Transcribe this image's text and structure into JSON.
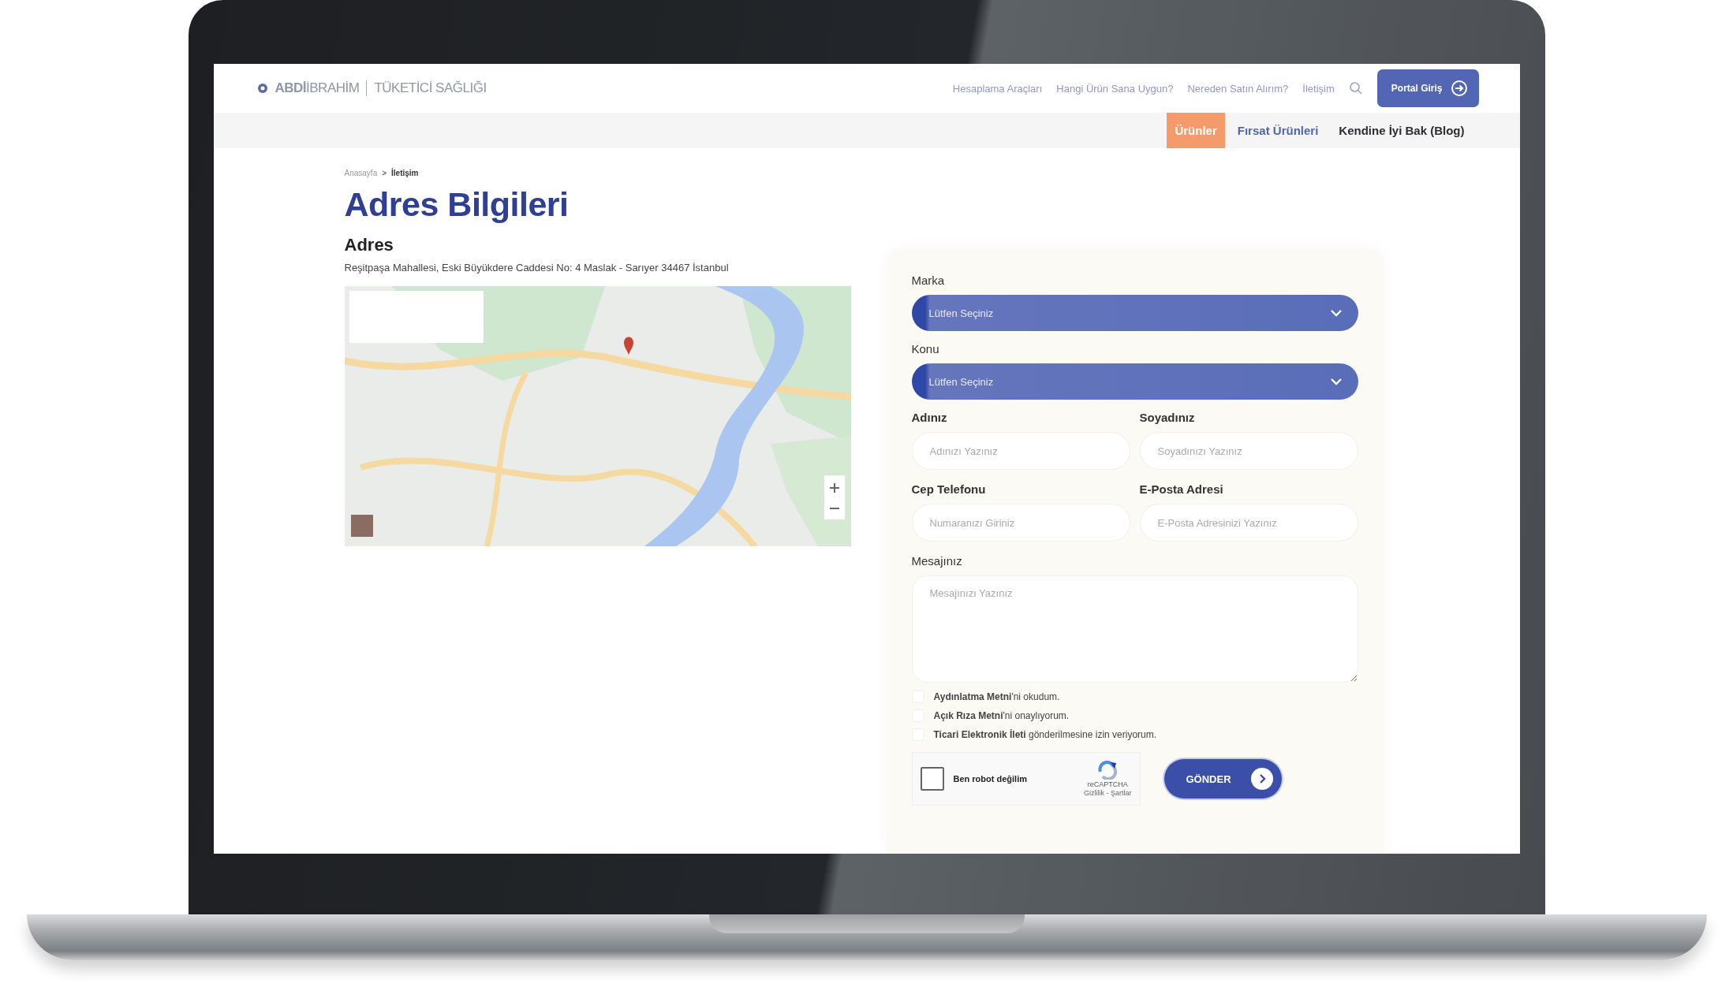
{
  "logo": {
    "brand": "**ABDİ**İBRAHİM",
    "subtitle": "TÜKETİCİ SAĞLIĞI"
  },
  "top_nav": [
    "Hesaplama Araçları",
    "Hangi Ürün Sana Uygun?",
    "Nereden Satın Alırım?",
    "İletişim"
  ],
  "portal_button": "Portal Giriş",
  "menu": [
    {
      "label": "Ürünler",
      "selected": true
    },
    {
      "label": "Fırsat Ürünleri",
      "selected": false
    },
    {
      "label": "Kendine İyi Bak (Blog)",
      "selected": false
    }
  ],
  "breadcrumb": {
    "separator": ">",
    "items": [
      {
        "label": "Anasayfa",
        "current": false
      },
      {
        "label": "İletişim",
        "current": true
      }
    ]
  },
  "title": "Adres Bilgileri",
  "address": {
    "heading": "Adres",
    "text": "Reşitpaşa Mahallesi, Eski Büyükdere Caddesi No: 4 Maslak - Sarıyer 34467 İstanbul"
  },
  "form": {
    "fields": [
      {
        "kind": "select",
        "label": "Marka",
        "value": "Lütfen Seçiniz"
      },
      {
        "kind": "select",
        "label": "Konu",
        "value": "Lütfen Seçiniz"
      },
      {
        "kind": "text",
        "label": "Adınız",
        "placeholder": "Adınızı Yazınız"
      },
      {
        "kind": "text",
        "label": "Soyadınız",
        "placeholder": "Soyadınızı Yazınız"
      },
      {
        "kind": "text",
        "label": "Cep Telefonu",
        "placeholder": "Numaranızı Giriniz"
      },
      {
        "kind": "text",
        "label": "E-Posta Adresi",
        "placeholder": "E-Posta Adresinizi Yazınız"
      },
      {
        "kind": "textarea",
        "label": "Mesajınız",
        "placeholder": "Mesajınızı Yazınız"
      }
    ],
    "consents": [
      {
        "text": "**Aydınlatma Metni**'ni okudum.",
        "checked": false
      },
      {
        "text": "**Açık Rıza Metni**'ni onaylıyorum.",
        "checked": false
      },
      {
        "text": "**Ticari Elektronik İleti** gönderilmesine izin veriyorum.",
        "checked": false
      }
    ],
    "captcha": {
      "label": "Ben robot değilim",
      "checked": false,
      "brand": "reCAPTCHA",
      "links": "Gizlilik - Şartlar"
    },
    "submit": "GÖNDER"
  }
}
